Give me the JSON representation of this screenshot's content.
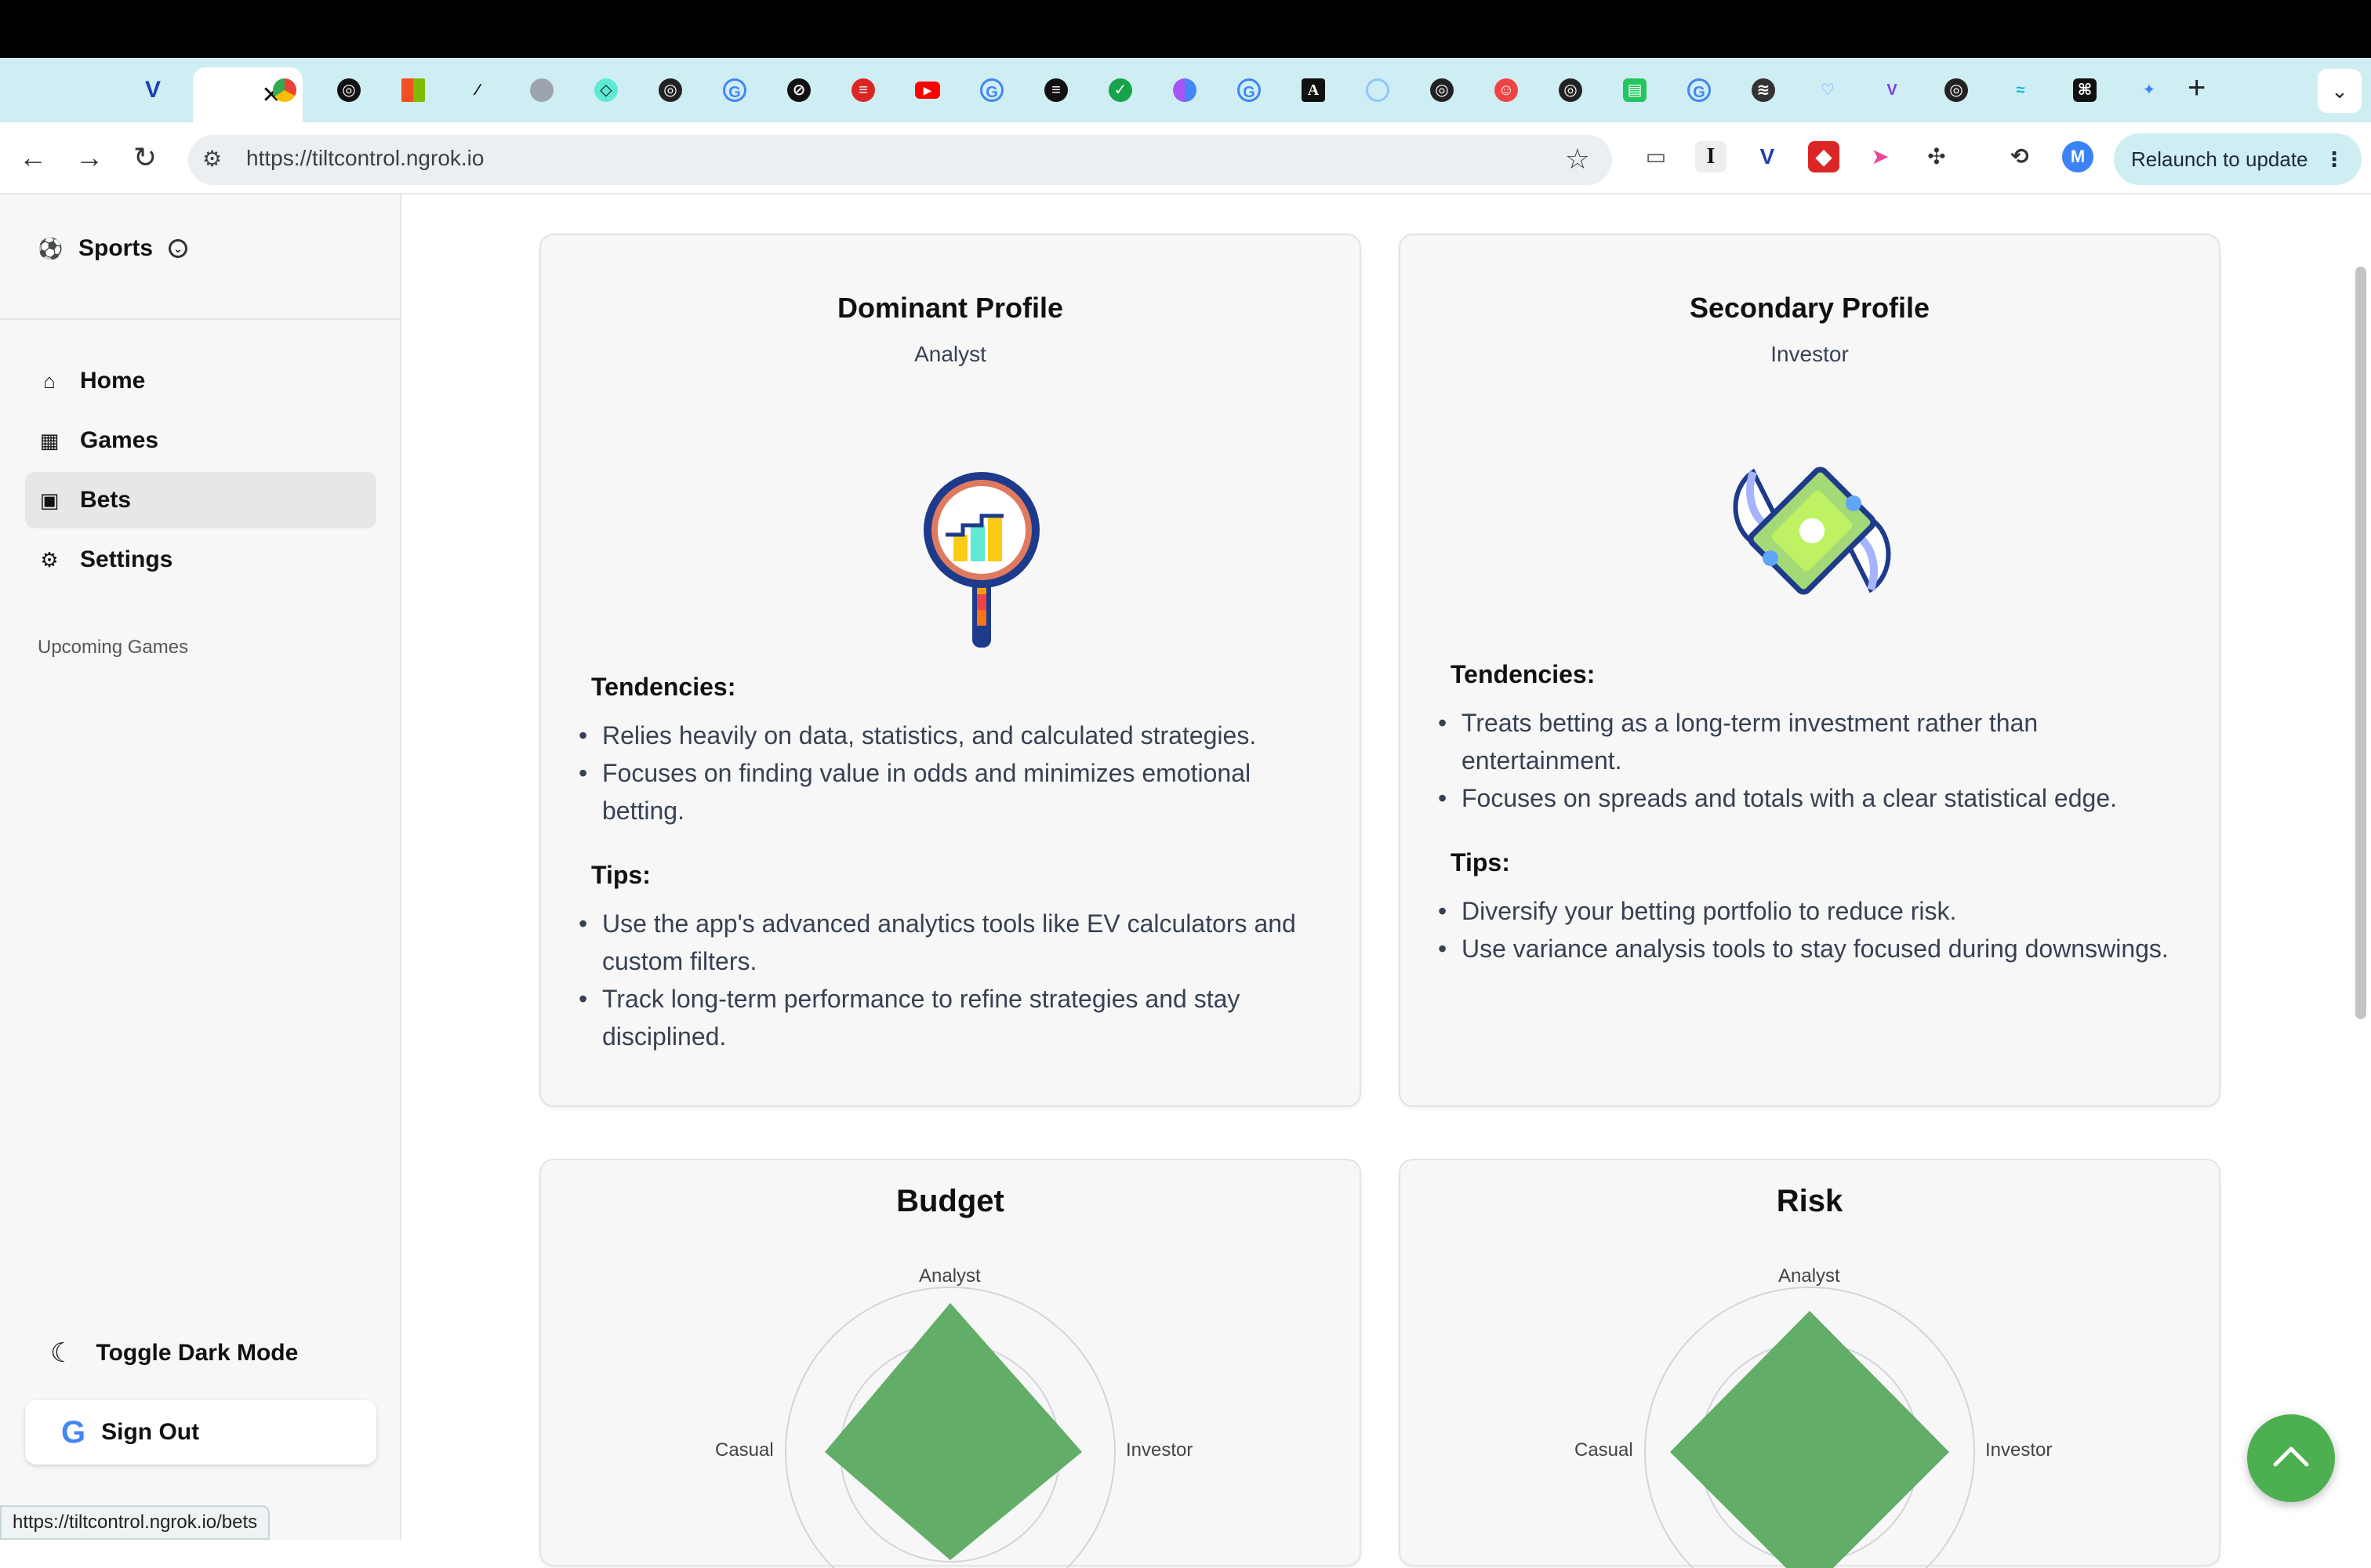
{
  "browser": {
    "url": "https://tiltcontrol.ngrok.io",
    "relaunch_label": "Relaunch to update",
    "status_url": "https://tiltcontrol.ngrok.io/bets"
  },
  "sidebar": {
    "sport_selector": "Sports",
    "items": [
      {
        "label": "Home",
        "icon": "home-icon"
      },
      {
        "label": "Games",
        "icon": "calendar-icon"
      },
      {
        "label": "Bets",
        "icon": "money-icon"
      },
      {
        "label": "Settings",
        "icon": "gear-icon"
      }
    ],
    "section_title": "Upcoming Games",
    "dark_mode_label": "Toggle Dark Mode",
    "sign_out_label": "Sign Out"
  },
  "profiles": {
    "dominant": {
      "title": "Dominant Profile",
      "type": "Analyst",
      "tendencies_label": "Tendencies:",
      "tendencies": [
        "Relies heavily on data, statistics, and calculated strategies.",
        "Focuses on finding value in odds and minimizes emotional betting."
      ],
      "tips_label": "Tips:",
      "tips": [
        "Use the app's advanced analytics tools like EV calculators and custom filters.",
        "Track long-term performance to refine strategies and stay disciplined."
      ]
    },
    "secondary": {
      "title": "Secondary Profile",
      "type": "Investor",
      "tendencies_label": "Tendencies:",
      "tendencies": [
        "Treats betting as a long-term investment rather than entertainment.",
        "Focuses on spreads and totals with a clear statistical edge."
      ],
      "tips_label": "Tips:",
      "tips": [
        "Diversify your betting portfolio to reduce risk.",
        "Use variance analysis tools to stay focused during downswings."
      ]
    }
  },
  "charts": {
    "budget": {
      "title": "Budget",
      "axis_top": "Analyst",
      "axis_left": "Casual",
      "axis_right": "Investor"
    },
    "risk": {
      "title": "Risk",
      "axis_top": "Analyst",
      "axis_left": "Casual",
      "axis_right": "Investor"
    }
  },
  "colors": {
    "accent_green": "#4caf50",
    "radar_fill": "#5aa95f"
  }
}
